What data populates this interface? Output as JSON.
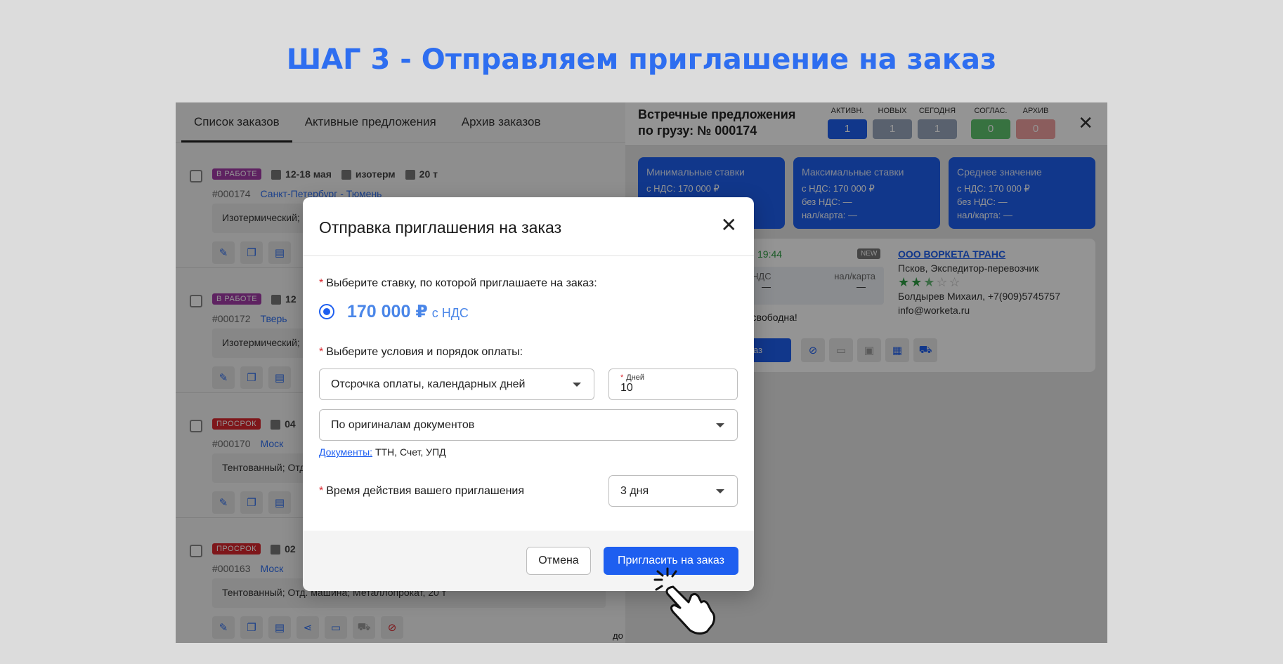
{
  "headline": "ШАГ 3 - Отправляем приглашение на заказ",
  "tabs": [
    "Список заказов",
    "Активные предложения",
    "Архив заказов"
  ],
  "orders": [
    {
      "status": "В РАБОТЕ",
      "status_type": "work",
      "dates": "12-18 мая",
      "body": "изотерм",
      "weight": "20 т",
      "id": "#000174",
      "route": "Санкт-Петербург - Тюмень",
      "desc": "Изотермический;"
    },
    {
      "status": "В РАБОТЕ",
      "status_type": "work",
      "dates": "12",
      "body": "",
      "weight": "",
      "id": "#000172",
      "route": "Тверь",
      "desc": "Изотермический;"
    },
    {
      "status": "ПРОСРОК",
      "status_type": "late",
      "dates": "04",
      "body": "",
      "weight": "",
      "id": "#000170",
      "route": "Моск",
      "desc": "Тентованный; Отд"
    },
    {
      "status": "ПРОСРОК",
      "status_type": "late",
      "dates": "02",
      "body": "",
      "weight": "",
      "id": "#000163",
      "route": "Моск",
      "desc": "Тентованный; Отд. машина; Металлопрокат, 20 т"
    }
  ],
  "bottom_text": "до",
  "panel": {
    "title_line1": "Встречные предложения",
    "title_line2": "по грузу: № 000174",
    "counters": [
      {
        "label": "АКТИВН.",
        "value": "1",
        "color": "#1e5ff0"
      },
      {
        "label": "НОВЫХ",
        "value": "1",
        "color": "#9aa8bd"
      },
      {
        "label": "СЕГОДНЯ",
        "value": "1",
        "color": "#9aa8bd"
      },
      {
        "label": "СОГЛАС.",
        "value": "0",
        "color": "#5fc56f"
      },
      {
        "label": "АРХИВ",
        "value": "0",
        "color": "#f0a0a0"
      }
    ],
    "stats": [
      {
        "title": "Минимальные ставки",
        "lines": [
          "с НДС: 170 000 ₽",
          "",
          ""
        ]
      },
      {
        "title": "Максимальные ставки",
        "lines": [
          "с НДС: 170 000 ₽",
          "без НДС: —",
          "нал/карта: —"
        ]
      },
      {
        "title": "Среднее значение",
        "lines": [
          "с НДС: 170 000 ₽",
          "без НДС: —",
          "нал/карта: —"
        ]
      }
    ],
    "offer": {
      "time": "19:44",
      "new_badge": "NEW",
      "nds_label": "НДС",
      "cash_label": "нал/карта",
      "dash": "—",
      "free_text": "а свободна!",
      "invite_short": "аз",
      "company": "ООО ВОРКЕТА ТРАНС",
      "company_type": "Псков, Экспедитор-перевозчик",
      "rating": 2.5,
      "contact": "Болдырев Михаил, +7(909)5745757",
      "email": "info@worketa.ru"
    }
  },
  "modal": {
    "title": "Отправка приглашения на заказ",
    "q_rate": "Выберите ставку, по которой приглашаете на заказ:",
    "rate_amount": "170 000 ₽",
    "rate_vat": "с НДС",
    "q_terms": "Выберите условия и порядок оплаты:",
    "terms_value": "Отсрочка оплаты, календарных дней",
    "days_label": "Дней",
    "days_value": "10",
    "docs_value": "По оригиналам документов",
    "docs_link": "Документы:",
    "docs_list": " ТТН, Счет, УПД",
    "q_validity": "Время действия вашего приглашения",
    "validity_value": "3 дня",
    "cancel": "Отмена",
    "invite": "Пригласить на заказ"
  }
}
